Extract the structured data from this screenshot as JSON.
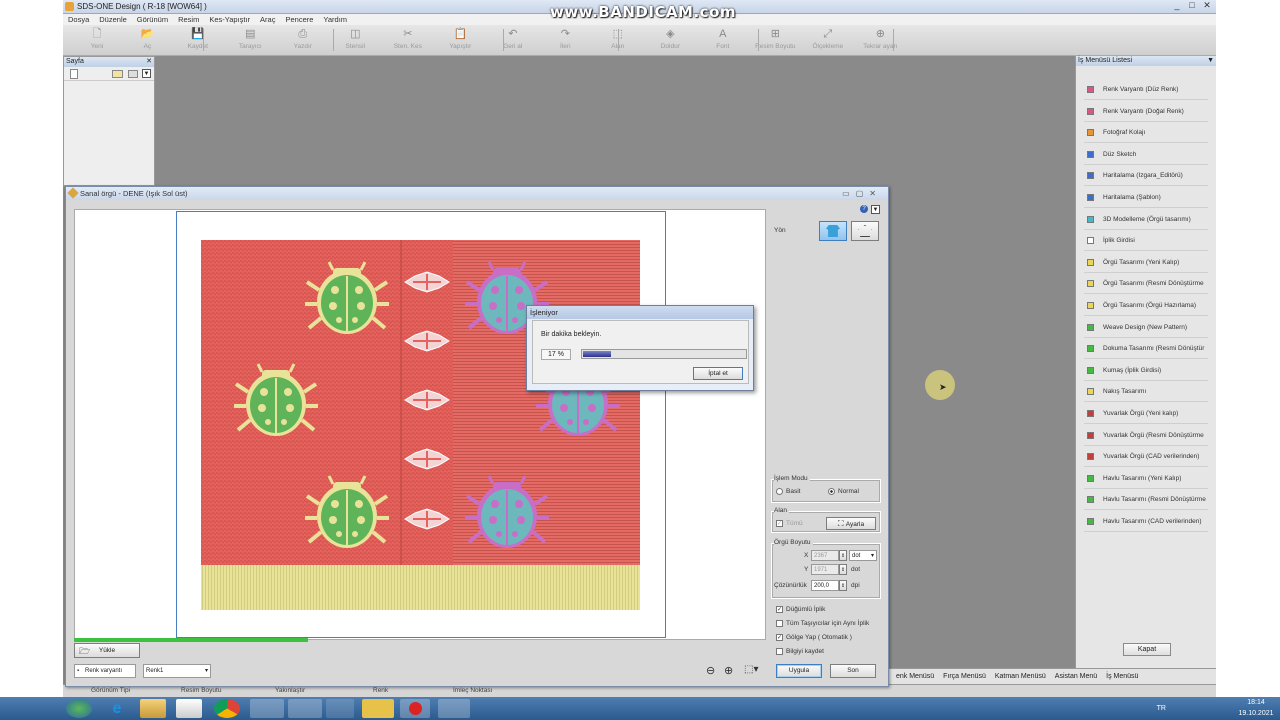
{
  "window": {
    "title": "SDS-ONE Design ( R-18 [WOW64] )",
    "watermark": "www.BANDICAM.com",
    "controls": [
      "_",
      "□",
      "✕"
    ]
  },
  "menubar": [
    "Dosya",
    "Düzenle",
    "Görünüm",
    "Resim",
    "Kes-Yapıştır",
    "Araç",
    "Pencere",
    "Yardım"
  ],
  "toolbar": [
    {
      "label": "Yeni",
      "icon": "new-file-icon",
      "glyph": "🗋"
    },
    {
      "label": "Aç",
      "icon": "open-folder-icon",
      "glyph": "📂"
    },
    {
      "label": "Kaydet",
      "icon": "save-icon",
      "glyph": "💾"
    },
    {
      "label": "Tarayıcı",
      "icon": "scanner-icon",
      "glyph": "▤"
    },
    {
      "label": "Yazdır",
      "icon": "print-icon",
      "glyph": "⎙"
    },
    {
      "label": "Stensil",
      "icon": "stencil-icon",
      "glyph": "◫"
    },
    {
      "label": "Sten. Kes",
      "icon": "stencil-cut-icon",
      "glyph": "✂"
    },
    {
      "label": "Yapıştır",
      "icon": "paste-icon",
      "glyph": "📋"
    },
    {
      "label": "Geri al",
      "icon": "undo-icon",
      "glyph": "↶"
    },
    {
      "label": "İleri",
      "icon": "redo-icon",
      "glyph": "↷"
    },
    {
      "label": "Alan",
      "icon": "area-icon",
      "glyph": "⬚"
    },
    {
      "label": "Doldur",
      "icon": "fill-icon",
      "glyph": "◈"
    },
    {
      "label": "Font",
      "icon": "font-icon",
      "glyph": "A"
    },
    {
      "label": "Resim Boyutu",
      "icon": "image-size-icon",
      "glyph": "⊞"
    },
    {
      "label": "Ölçekleme",
      "icon": "scale-icon",
      "glyph": "⤢"
    },
    {
      "label": "Tekrar ayarı",
      "icon": "repeat-icon",
      "glyph": "⊕"
    }
  ],
  "page_panel": {
    "title": "Sayfa",
    "close": "✕"
  },
  "right_panel": {
    "title": "İş Menüsü Listesi",
    "items": [
      {
        "label": "Renk Varyantı (Düz Renk)",
        "color": "#d9558a"
      },
      {
        "label": "Renk Varyantı (Doğal Renk)",
        "color": "#d9558a"
      },
      {
        "label": "Fotoğraf Kolajı",
        "color": "#e5953a"
      },
      {
        "label": "Düz Sketch",
        "color": "#3b6fc9"
      },
      {
        "label": "Haritalama (Izgara_Editörü)",
        "color": "#3b6fc9"
      },
      {
        "label": "Haritalama (Şablon)",
        "color": "#3b6fc9"
      },
      {
        "label": "3D Modelleme (Örgü tasarımı)",
        "color": "#47b8c9"
      },
      {
        "label": "İplik Girdisi",
        "color": "#ffffff"
      },
      {
        "label": "Örgü Tasarımı (Yeni Kalıp)",
        "color": "#e9d55a"
      },
      {
        "label": "Örgü Tasarımı (Resmi Dönüştürme",
        "color": "#e9d55a"
      },
      {
        "label": "Örgü Tasarımı (Örgü Hazırlama)",
        "color": "#e9d55a"
      },
      {
        "label": "Weave Design (New Pattern)",
        "color": "#45b845"
      },
      {
        "label": "Dokuma Tasarımı (Resmi Dönüştür",
        "color": "#45b845"
      },
      {
        "label": "Kumaş (İplik Girdisi)",
        "color": "#45b845"
      },
      {
        "label": "Nakış Tasarımı",
        "color": "#e9d55a"
      },
      {
        "label": "Yuvarlak Örgü (Yeni kalıp)",
        "color": "#c0403f"
      },
      {
        "label": "Yuvarlak Örgü (Resmi Dönüştürme",
        "color": "#c0403f"
      },
      {
        "label": "Yuvarlak Örgü (CAD verilerinden)",
        "color": "#c0403f"
      },
      {
        "label": "Havlu Tasarımı (Yeni Kalıp)",
        "color": "#45b845"
      },
      {
        "label": "Havlu Tasarımı (Resmi Dönüştürme",
        "color": "#45b845"
      },
      {
        "label": "Havlu Tasarımı (CAD verilerinden)",
        "color": "#45b845"
      }
    ],
    "close_button": "Kapat"
  },
  "bottom_menus": [
    "enk Menüsü",
    "Fırça Menüsü",
    "Katman Menüsü",
    "Asistan Menü",
    "İş Menüsü"
  ],
  "statusbar": [
    "Görünüm Tipi",
    "Resim Boyutu",
    "Yakınlaştır",
    "Renk",
    "İmleç Noktası"
  ],
  "dialog": {
    "title": "Sanal örgü - DENE (Işık Sol üst)",
    "yon_label": "Yön",
    "islem_modu": {
      "label": "İşlem Modu",
      "options": [
        "Basit",
        "Normal"
      ],
      "selected": "Normal"
    },
    "alan": {
      "label": "Alan",
      "tumu": "Tümü",
      "ayarla": "Ayarla"
    },
    "orgu_boyutu": {
      "label": "Örgü Boyutu",
      "x_label": "X",
      "x_value": "2367",
      "unit": "dot",
      "y_label": "Y",
      "y_value": "1971",
      "y_unit": "dot",
      "cozunurluk_label": "Çözünürlük",
      "cozunurluk_value": "200,0",
      "cozunurluk_unit": "dpi"
    },
    "checkboxes": [
      {
        "label": "Düğümlü İplik",
        "checked": true
      },
      {
        "label": "Tüm Taşıyıcılar için Aynı İplik",
        "checked": false
      },
      {
        "label": "Gölge Yap ( Otomatik )",
        "checked": true
      },
      {
        "label": "Bilgiyi kaydet",
        "checked": false
      }
    ],
    "yukle": "Yükle",
    "renk_varyanti": "Renk varyantı",
    "renk1": "Renk1",
    "uygula": "Uygula",
    "son": "Son"
  },
  "progress": {
    "title": "İşleniyor",
    "message": "Bir dakika bekleyin.",
    "percent_text": "17 %",
    "percent": 17,
    "cancel": "İptal et"
  },
  "taskbar": {
    "lang": "TR",
    "time": "18:14",
    "date": "19.10.2021"
  }
}
